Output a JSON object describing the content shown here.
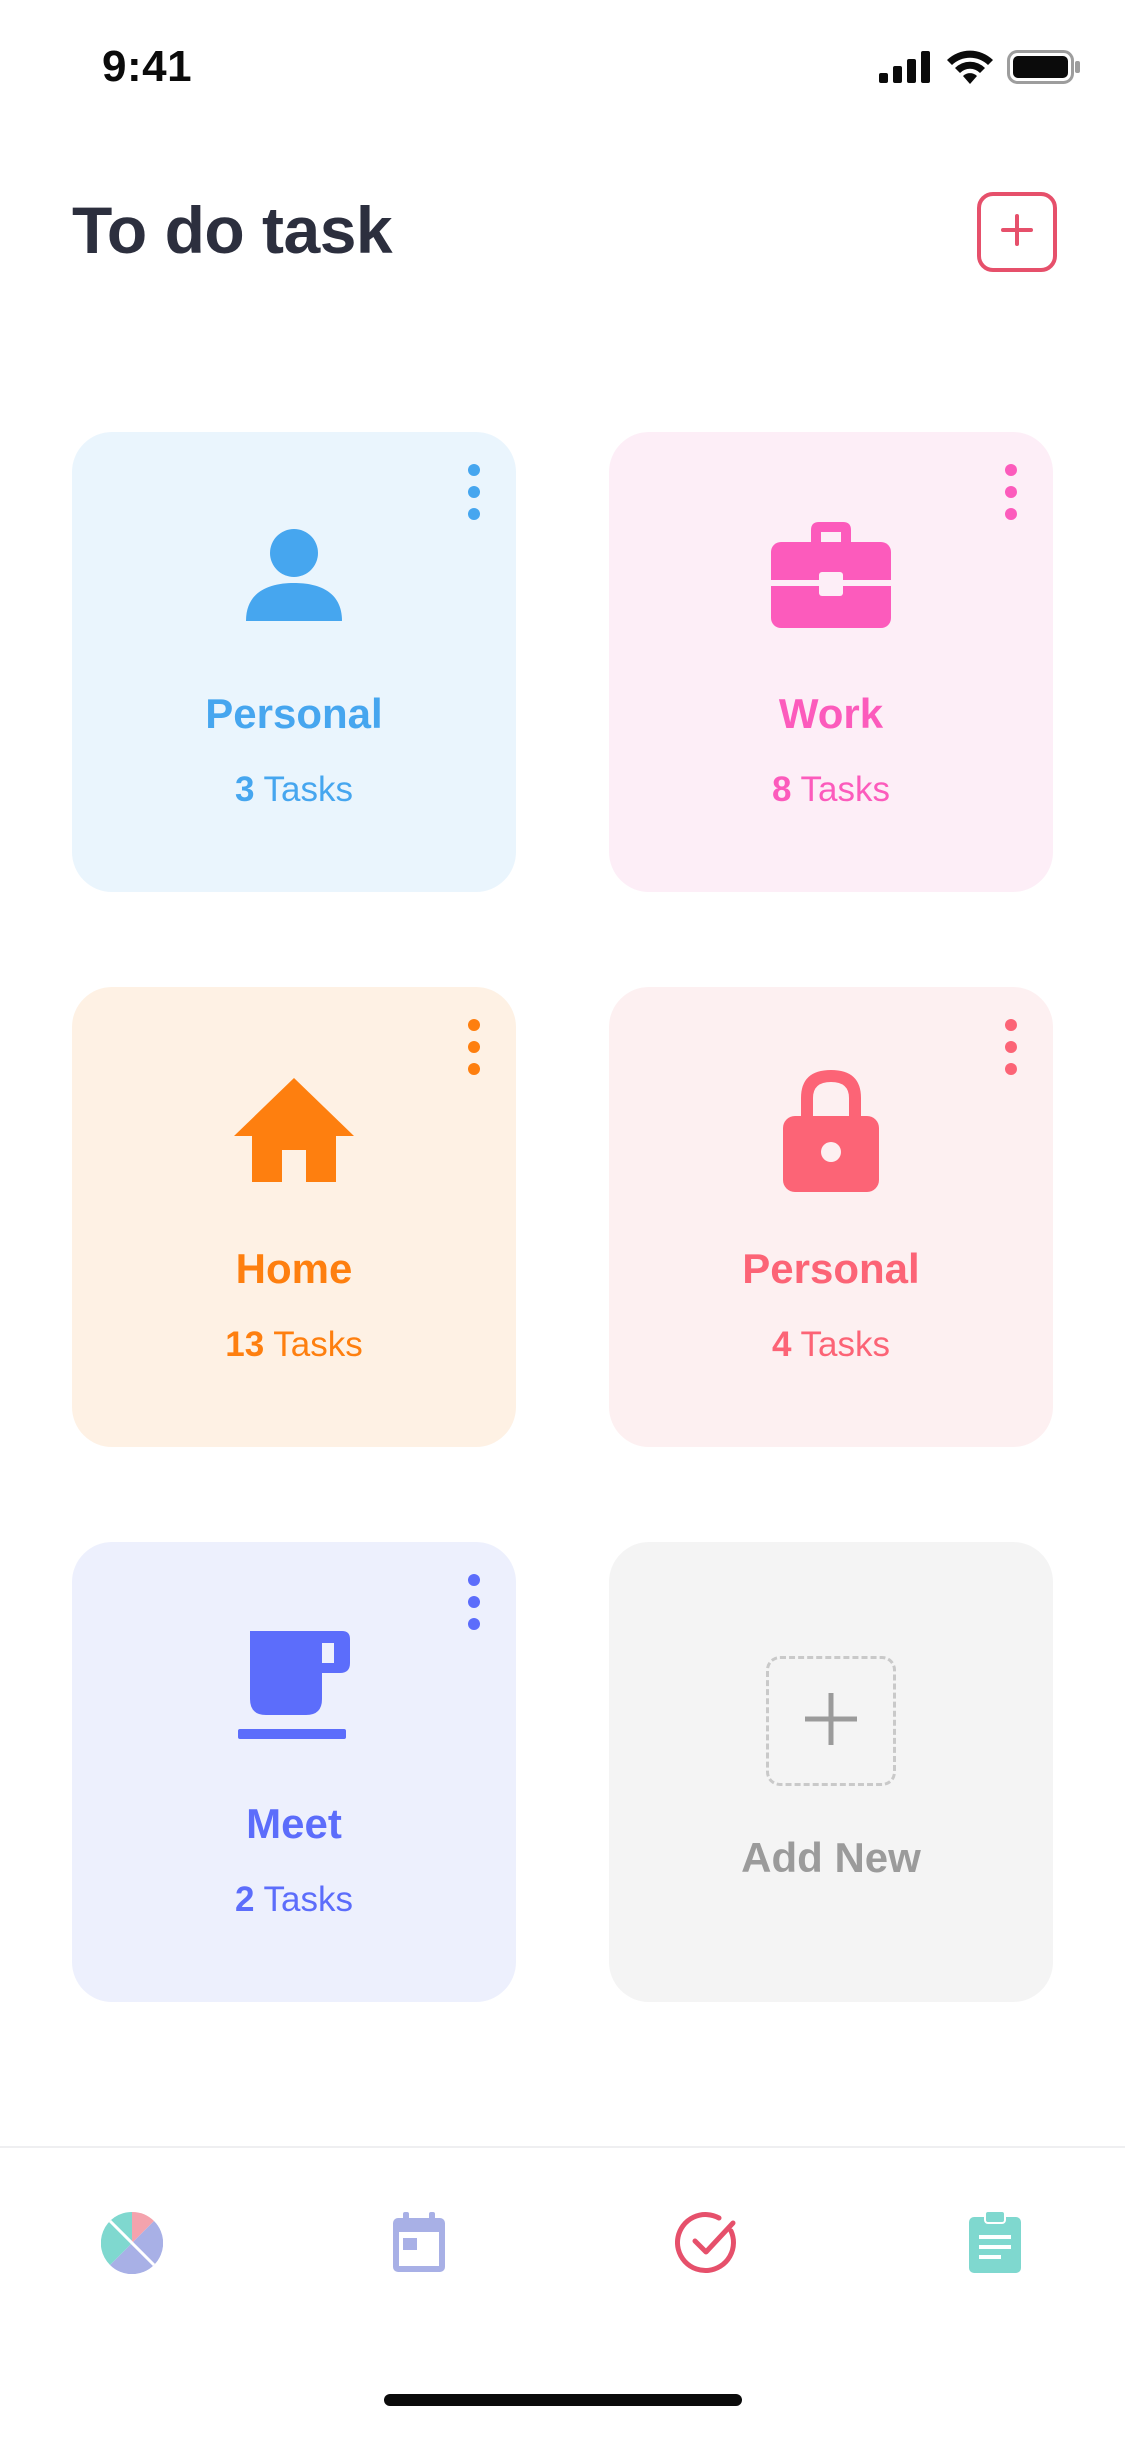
{
  "status_bar": {
    "time": "9:41"
  },
  "header": {
    "title": "To do task",
    "add_icon": "plus-icon",
    "accent_color": "#e6506b"
  },
  "cards": [
    {
      "title": "Personal",
      "count": "3",
      "count_suffix": "Tasks",
      "icon": "person-icon",
      "color": "#46a6ef",
      "background": "#eaf5fd"
    },
    {
      "title": "Work",
      "count": "8",
      "count_suffix": "Tasks",
      "icon": "briefcase-icon",
      "color": "#fc5bbc",
      "background": "#fdeef7"
    },
    {
      "title": "Home",
      "count": "13",
      "count_suffix": "Tasks",
      "icon": "house-icon",
      "color": "#fe7f0f",
      "background": "#fef1e4"
    },
    {
      "title": "Personal",
      "count": "4",
      "count_suffix": "Tasks",
      "icon": "lock-icon",
      "color": "#fc6476",
      "background": "#fdf0f1"
    },
    {
      "title": "Meet",
      "count": "2",
      "count_suffix": "Tasks",
      "icon": "coffee-cup-icon",
      "color": "#5c6dfb",
      "background": "#edf0fd"
    }
  ],
  "add_new": {
    "label": "Add New",
    "icon": "plus-icon",
    "color": "#9b9b9b"
  },
  "bottom_nav": [
    {
      "icon": "dashboard-pie-icon",
      "color": "#a8b0e6"
    },
    {
      "icon": "calendar-icon",
      "color": "#a8b0e6"
    },
    {
      "icon": "check-circle-icon",
      "color": "#e6506b"
    },
    {
      "icon": "clipboard-icon",
      "color": "#7fd8cf"
    }
  ]
}
